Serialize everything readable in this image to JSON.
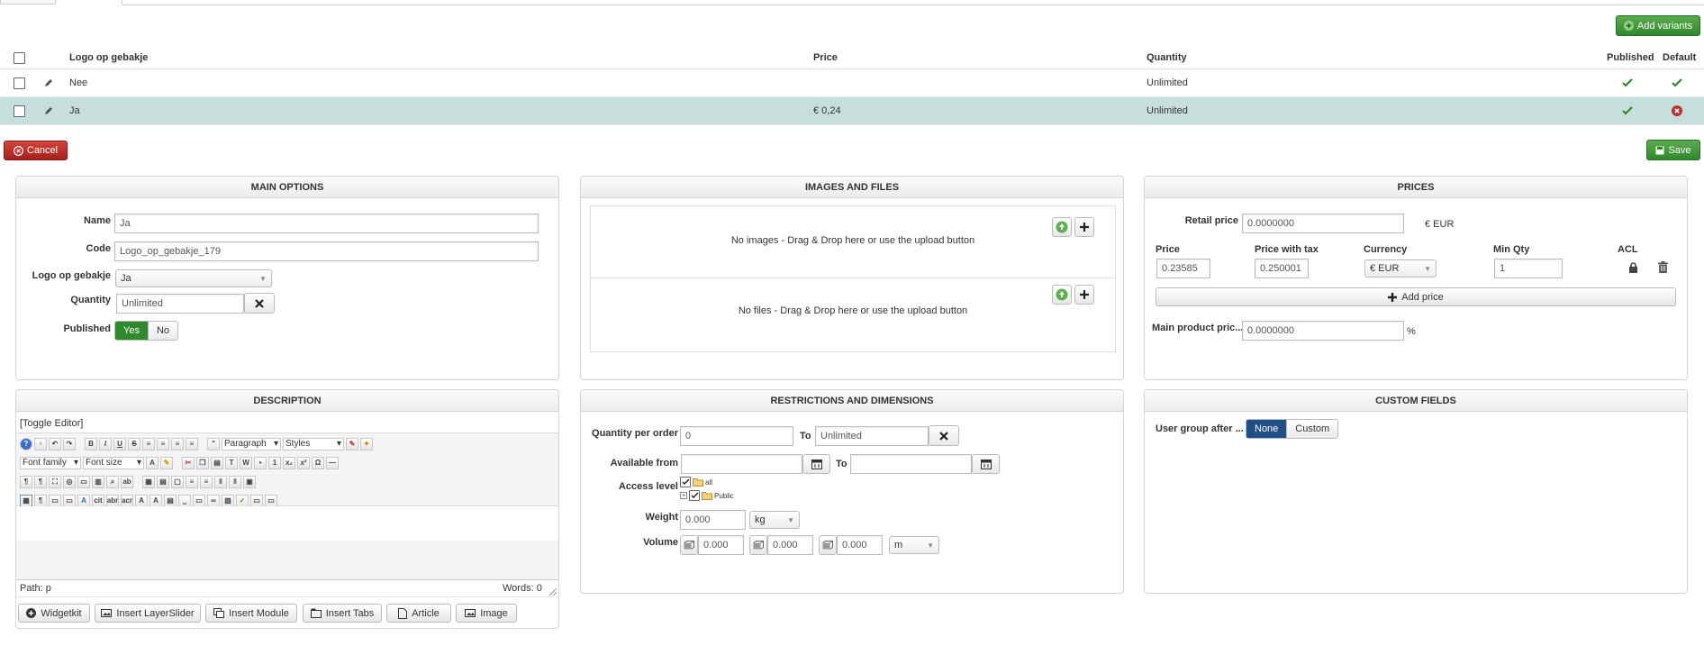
{
  "toolbar": {
    "add_variants_label": "Add variants",
    "cancel_label": "Cancel",
    "save_label": "Save"
  },
  "variants_table": {
    "headers": {
      "name": "Logo op gebakje",
      "price": "Price",
      "quantity": "Quantity",
      "published": "Published",
      "default": "Default"
    },
    "rows": [
      {
        "name": "Nee",
        "price": "",
        "quantity": "Unlimited",
        "published": true,
        "default": true,
        "selected": false
      },
      {
        "name": "Ja",
        "price": "€ 0,24",
        "quantity": "Unlimited",
        "published": true,
        "default": false,
        "selected": true
      }
    ]
  },
  "main_options": {
    "title": "MAIN OPTIONS",
    "name_label": "Name",
    "name_value": "Ja",
    "code_label": "Code",
    "code_value": "Logo_op_gebakje_179",
    "logo_label": "Logo op gebakje",
    "logo_value": "Ja",
    "quantity_label": "Quantity",
    "quantity_value": "Unlimited",
    "published_label": "Published",
    "published_yes": "Yes",
    "published_no": "No"
  },
  "images_files": {
    "title": "IMAGES AND FILES",
    "no_images": "No images - Drag & Drop here or use the upload button",
    "no_files": "No files - Drag & Drop here or use the upload button"
  },
  "prices": {
    "title": "PRICES",
    "retail_label": "Retail price",
    "retail_value": "0.0000000",
    "retail_currency": "€ EUR",
    "col_price": "Price",
    "col_price_tax": "Price with tax",
    "col_currency": "Currency",
    "col_min_qty": "Min Qty",
    "col_acl": "ACL",
    "price_value": "0.23585",
    "price_tax_value": "0.250001",
    "currency_value": "€ EUR",
    "min_qty_value": "1",
    "add_price_label": "Add price",
    "main_price_label": "Main product pric...",
    "main_price_value": "0.0000000",
    "main_price_unit": "%"
  },
  "description": {
    "title": "DESCRIPTION",
    "toggle_editor": "[Toggle Editor]",
    "paragraph": "Paragraph",
    "styles": "Styles",
    "font_family": "Font family",
    "font_size": "Font size",
    "path": "Path: p",
    "words": "Words: 0",
    "buttons": [
      "Widgetkit",
      "Insert LayerSlider",
      "Insert Module",
      "Insert Tabs",
      "Article",
      "Image"
    ]
  },
  "restrictions": {
    "title": "RESTRICTIONS AND DIMENSIONS",
    "qpo_label": "Quantity per order",
    "qpo_from": "0",
    "to_label": "To",
    "qpo_to": "Unlimited",
    "available_label": "Available from",
    "available_to_label": "To",
    "access_label": "Access level",
    "access_all": "all",
    "access_public": "Public",
    "weight_label": "Weight",
    "weight_value": "0.000",
    "weight_unit": "kg",
    "volume_label": "Volume",
    "volume_x": "0.000",
    "volume_y": "0.000",
    "volume_z": "0.000",
    "volume_unit": "m"
  },
  "custom_fields": {
    "title": "CUSTOM FIELDS",
    "user_group_label": "User group after ...",
    "none_label": "None",
    "custom_label": "Custom"
  },
  "colors": {
    "green": "#2f8a2c",
    "red": "#a5201d",
    "blue": "#1f4f86",
    "selected_row": "#c7dfdc"
  }
}
